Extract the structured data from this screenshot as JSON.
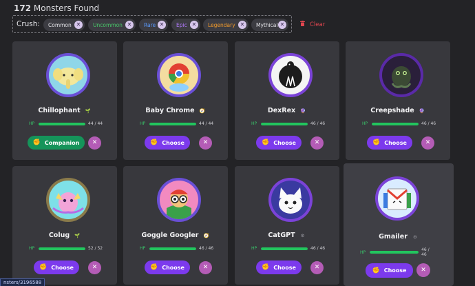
{
  "header": {
    "count": "172",
    "count_suffix": " Monsters Found"
  },
  "filters": {
    "label": "Crush:",
    "chips": [
      {
        "label": "Common",
        "color": "#e6e6ea"
      },
      {
        "label": "Uncommon",
        "color": "#49c96a"
      },
      {
        "label": "Rare",
        "color": "#5b9bff"
      },
      {
        "label": "Epic",
        "color": "#b27aff"
      },
      {
        "label": "Legendary",
        "color": "#f29b2c"
      },
      {
        "label": "Mythical",
        "color": "#e6e6ea"
      }
    ],
    "chip_remove_glyph": "✕",
    "clear_label": "Clear"
  },
  "cards": [
    {
      "name": "Chillophant",
      "rarity_icon": "sprout-icon",
      "rarity_glyph": "🌱",
      "rarity_color": "#5fbf5a",
      "hp_label": "HP",
      "hp": "44 / 44",
      "hp_fraction": 1.0,
      "button": "Companion",
      "button_type": "companion",
      "ring": "#6a4fd6",
      "ring2": "#c4a94a"
    },
    {
      "name": "Baby Chrome",
      "rarity_icon": "compass-icon",
      "rarity_glyph": "🧭",
      "rarity_color": "#f2b441",
      "hp_label": "HP",
      "hp": "44 / 44",
      "hp_fraction": 1.0,
      "button": "Choose",
      "button_type": "choose",
      "ring": "#6a4fd6",
      "ring2": "#3d6ad0"
    },
    {
      "name": "DexRex",
      "rarity_icon": "crystal-ball-icon",
      "rarity_glyph": "🔮",
      "rarity_color": "#a86bf0",
      "hp_label": "HP",
      "hp": "46 / 46",
      "hp_fraction": 1.0,
      "button": "Choose",
      "button_type": "choose",
      "ring": "#7b43d8",
      "ring2": "#5a2aa8"
    },
    {
      "name": "Creepshade",
      "rarity_icon": "crystal-ball-icon",
      "rarity_glyph": "🔮",
      "rarity_color": "#a86bf0",
      "hp_label": "HP",
      "hp": "46 / 46",
      "hp_fraction": 1.0,
      "button": "Choose",
      "button_type": "choose",
      "ring": "#7b43d8",
      "ring2": "#4b2e8a"
    },
    {
      "name": "Colug",
      "rarity_icon": "sprout-icon",
      "rarity_glyph": "🌱",
      "rarity_color": "#5fbf5a",
      "hp_label": "HP",
      "hp": "52 / 52",
      "hp_fraction": 1.0,
      "button": "Choose",
      "button_type": "choose",
      "ring": "#8a7a4a",
      "ring2": "#c4a94a"
    },
    {
      "name": "Goggle Googler",
      "rarity_icon": "compass-icon",
      "rarity_glyph": "🧭",
      "rarity_color": "#f2b441",
      "hp_label": "HP",
      "hp": "46 / 46",
      "hp_fraction": 1.0,
      "button": "Choose",
      "button_type": "choose",
      "ring": "#6a4fd6",
      "ring2": "#3d6ad0"
    },
    {
      "name": "CatGPT",
      "rarity_icon": "gear-icon",
      "rarity_glyph": "⚙",
      "rarity_color": "#9a9aa2",
      "hp_label": "HP",
      "hp": "46 / 46",
      "hp_fraction": 1.0,
      "button": "Choose",
      "button_type": "choose",
      "ring": "#7b43d8",
      "ring2": "#5a2aa8"
    },
    {
      "name": "Gmailer",
      "rarity_icon": "gear-icon",
      "rarity_glyph": "⚙",
      "rarity_color": "#9a9aa2",
      "hp_label": "HP",
      "hp": "46 / 46",
      "hp_fraction": 1.0,
      "button": "Choose",
      "button_type": "choose",
      "ring": "#7b43d8",
      "ring2": "#5a2aa8"
    }
  ],
  "remove_button_glyph": "✕",
  "status_url": "nsters/3196588"
}
